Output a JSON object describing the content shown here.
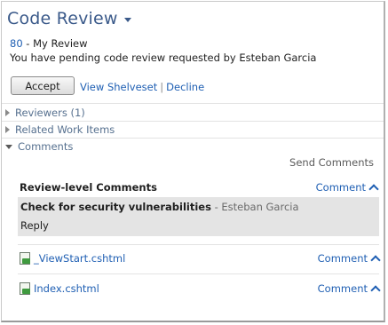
{
  "header": {
    "title": "Code Review"
  },
  "review": {
    "id": "80",
    "name": " - My Review",
    "message": "You have pending code review requested by Esteban Garcia"
  },
  "actions": {
    "accept_label": "Accept",
    "view_shelveset_label": "View Shelveset",
    "separator": "|",
    "decline_label": "Decline"
  },
  "sections": {
    "reviewers": "Reviewers (1)",
    "related_work_items": "Related Work Items",
    "comments": "Comments"
  },
  "send_comments_label": "Send Comments",
  "review_level": {
    "title": "Review-level Comments",
    "comment_link": "Comment",
    "comment_text": "Check for security vulnerabilities",
    "author": " - Esteban Garcia",
    "reply_label": "Reply"
  },
  "files": [
    {
      "name": "_ViewStart.cshtml",
      "comment_link": "Comment"
    },
    {
      "name": "Index.cshtml",
      "comment_link": "Comment"
    }
  ],
  "colors": {
    "title_blue": "#3b5a8a",
    "link_blue": "#1f5fb3",
    "comment_bg": "#e4e4e4"
  }
}
